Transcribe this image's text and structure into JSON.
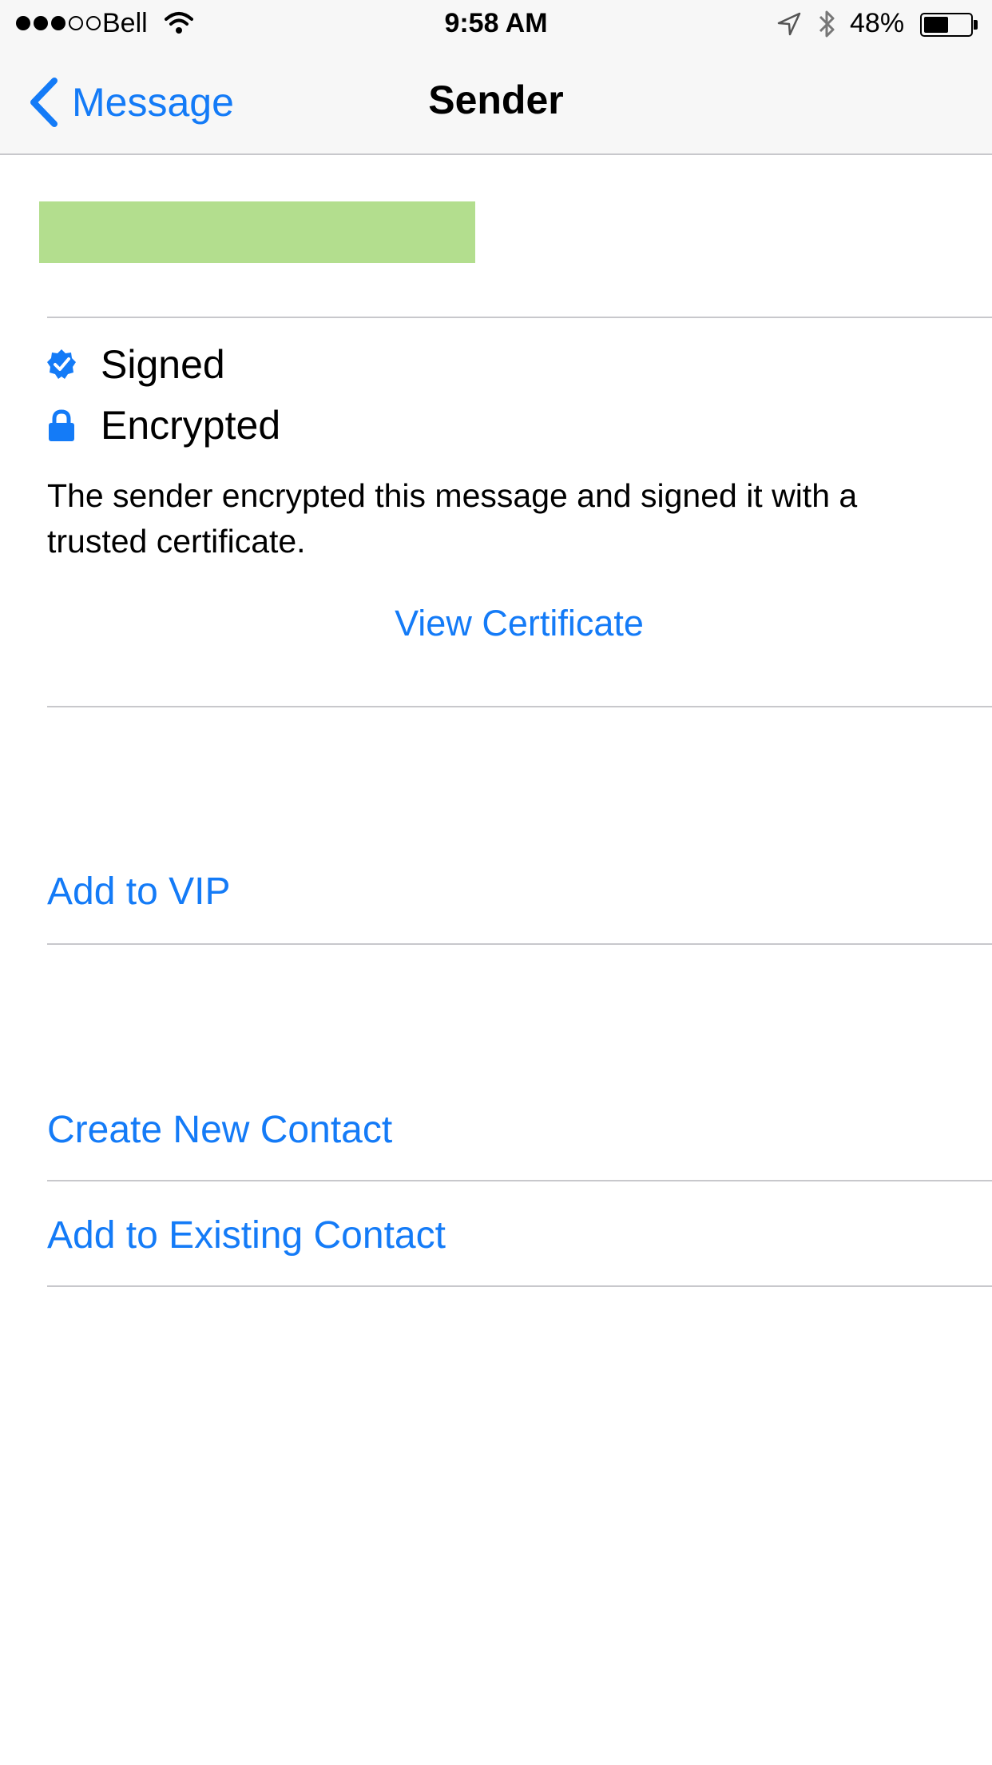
{
  "status_bar": {
    "carrier": "Bell",
    "signal_bars": 3,
    "signal_total": 5,
    "time": "9:58 AM",
    "battery_percent": "48%",
    "battery_level": 0.48
  },
  "nav": {
    "back_label": "Message",
    "title": "Sender"
  },
  "security": {
    "signed_label": "Signed",
    "encrypted_label": "Encrypted",
    "description": "The sender encrypted this message and signed it with a trusted certificate.",
    "view_certificate_label": "View Certificate"
  },
  "actions": {
    "add_vip": "Add to VIP",
    "create_contact": "Create New Contact",
    "add_existing": "Add to Existing Contact"
  },
  "colors": {
    "accent": "#147bf7",
    "redaction": "#b3de8e",
    "separator": "#c8c8cc",
    "header_bg": "#f7f7f7"
  }
}
